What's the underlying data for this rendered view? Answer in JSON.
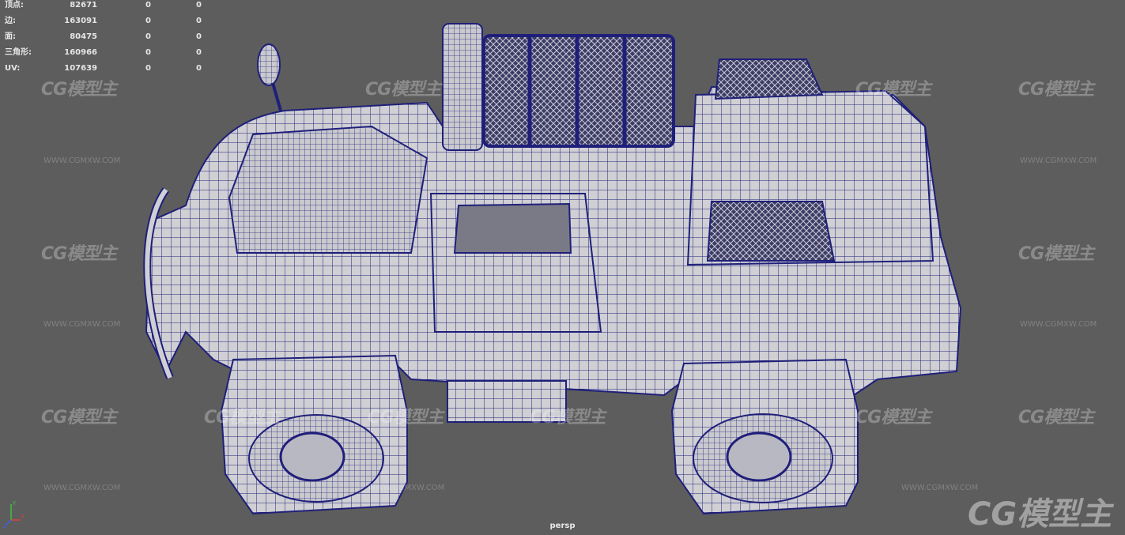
{
  "stats": {
    "rows": [
      {
        "label": "顶点:",
        "value": "82671",
        "sel": "0",
        "extra": "0"
      },
      {
        "label": "边:",
        "value": "163091",
        "sel": "0",
        "extra": "0"
      },
      {
        "label": "面:",
        "value": "80475",
        "sel": "0",
        "extra": "0"
      },
      {
        "label": "三角形:",
        "value": "160966",
        "sel": "0",
        "extra": "0"
      },
      {
        "label": "UV:",
        "value": "107639",
        "sel": "0",
        "extra": "0"
      }
    ]
  },
  "camera": {
    "name": "persp"
  },
  "axis": {
    "x": "X",
    "y": "Y",
    "z": "Z"
  },
  "watermark": {
    "logo": "CG模型主",
    "url": "WWW.CGMXW.COM"
  },
  "colors": {
    "background": "#5d5d5d",
    "wireframe": "#1f1f7a",
    "mesh": "#c8c8cc",
    "axis_x": "#e04040",
    "axis_y": "#40c040",
    "axis_z": "#4060e0"
  }
}
